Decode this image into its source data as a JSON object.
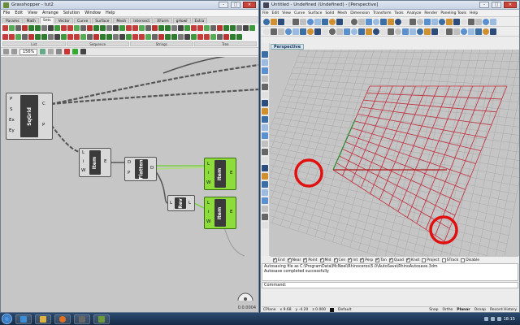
{
  "grasshopper": {
    "title": "Grasshopper - tut2",
    "file_label": "tut2",
    "menu": [
      "File",
      "Edit",
      "View",
      "Arrange",
      "Solution",
      "Window",
      "Help"
    ],
    "tabs": [
      "Params",
      "Math",
      "Sets",
      "Vector",
      "Curve",
      "Surface",
      "Mesh",
      "Intersect",
      "XForm",
      "gHowl",
      "Extra"
    ],
    "active_tab": "Sets",
    "groups": [
      "List",
      "Sequence",
      "Strings",
      "Tree"
    ],
    "zoom": "156%",
    "nodes": {
      "sqgrid": {
        "label": "SqGrid",
        "inputs": [
          "P",
          "S",
          "Ex",
          "Ey"
        ],
        "outputs": [
          "C",
          "P"
        ]
      },
      "item1": {
        "label": "Item",
        "inputs": [
          "L",
          "i",
          "W"
        ],
        "outputs": [
          "E"
        ]
      },
      "flatten": {
        "label": "Flatten",
        "inputs": [
          "D",
          "P"
        ],
        "outputs": [
          "D"
        ]
      },
      "rev": {
        "label": "Rev",
        "inputs": [
          "L"
        ],
        "outputs": [
          "L"
        ]
      },
      "item2": {
        "label": "Item",
        "inputs": [
          "L",
          "i",
          "W"
        ],
        "outputs": [
          "E"
        ]
      },
      "item3": {
        "label": "Item",
        "inputs": [
          "L",
          "i",
          "W"
        ],
        "outputs": [
          "E"
        ]
      }
    },
    "status_value": "0.0.0004"
  },
  "rhino": {
    "title": "Untitled - Undefined (Undefined) - [Perspective]",
    "menu": [
      "File",
      "Edit",
      "View",
      "Curve",
      "Surface",
      "Solid",
      "Mesh",
      "Dimension",
      "Transform",
      "Tools",
      "Analyze",
      "Render",
      "Paneling Tools",
      "Help"
    ],
    "viewport_label": "Perspective",
    "osnaps": [
      {
        "label": "End",
        "on": true
      },
      {
        "label": "Near",
        "on": true
      },
      {
        "label": "Point",
        "on": true
      },
      {
        "label": "Mid",
        "on": true
      },
      {
        "label": "Cen",
        "on": true
      },
      {
        "label": "Int",
        "on": true
      },
      {
        "label": "Perp",
        "on": true
      },
      {
        "label": "Tan",
        "on": true
      },
      {
        "label": "Quad",
        "on": true
      },
      {
        "label": "Knot",
        "on": true
      },
      {
        "label": "Project",
        "on": false
      },
      {
        "label": "STrack",
        "on": false
      },
      {
        "label": "Disable",
        "on": false
      }
    ],
    "command_history": [
      "Autosaving file as C:\\ProgramData\\McNeel\\Rhinoceros\\5.0\\AutoSave\\RhinoAutosave.3dm",
      "Autosave completed successfully"
    ],
    "command_prompt": "Command:",
    "status": {
      "cplane": "CPlane",
      "x": "x 9.68",
      "y": "y -4.20",
      "z": "z 0.000",
      "layer": "Default",
      "snap": "Snap",
      "ortho": "Ortho",
      "planar": "Planar",
      "osnap": "Osnap",
      "record": "Record History"
    }
  },
  "taskbar": {
    "clock": "18:15"
  },
  "colors": {
    "grid_major": "#c0303f",
    "grid_minor": "#a9a9a9",
    "highlight_circle": "#e01010",
    "node_green": "#8ddc3c"
  }
}
